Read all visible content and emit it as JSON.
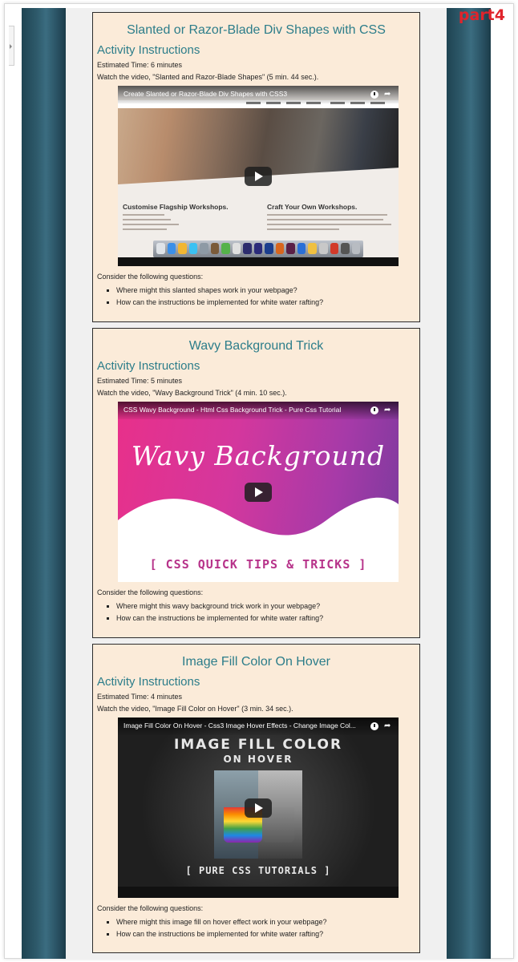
{
  "page": {
    "part_label": "part4"
  },
  "cards": [
    {
      "title": "Slanted or Razor-Blade Div Shapes with CSS",
      "instructions_heading": "Activity Instructions",
      "estimated_time": "Estimated Time: 6 minutes",
      "watch_text": "Watch the video, \"Slanted and Razor-Blade Shapes\" (5 min. 44 sec.).",
      "video": {
        "title": "Create Slanted or Razor-Blade Div Shapes with CSS3",
        "thumb_text_1": "Customise Flagship Workshops.",
        "thumb_text_2": "Craft Your Own Workshops."
      },
      "questions_intro": "Consider the following questions:",
      "questions": [
        "Where might this slanted shapes work in your webpage?",
        "How can the instructions be implemented for white water rafting?"
      ]
    },
    {
      "title": "Wavy Background Trick",
      "instructions_heading": "Activity Instructions",
      "estimated_time": "Estimated Time: 5 minutes",
      "watch_text": "Watch the video, \"Wavy Background Trick\" (4 min. 10 sec.).",
      "video": {
        "title": "CSS Wavy Background - Html Css Background Trick - Pure Css Tutorial",
        "thumb_text_1": "Wavy Background",
        "thumb_text_2": "[ CSS QUICK TIPS & TRICKS ]"
      },
      "questions_intro": "Consider the following questions:",
      "questions": [
        "Where might this wavy background trick work in your webpage?",
        "How can the instructions be implemented for white water rafting?"
      ]
    },
    {
      "title": "Image Fill Color On Hover",
      "instructions_heading": "Activity Instructions",
      "estimated_time": "Estimated Time: 4 minutes",
      "watch_text": "Watch the video, \"Image Fill Color on Hover\" (3 min. 34 sec.).",
      "video": {
        "title": "Image Fill Color On Hover - Css3 Image Hover Effects - Change Image Col...",
        "thumb_text_1": "IMAGE FILL COLOR",
        "thumb_text_2": "ON HOVER",
        "thumb_text_3": "[ PURE CSS TUTORIALS ]"
      },
      "questions_intro": "Consider the following questions:",
      "questions": [
        "Where might this image fill on hover effect work in your webpage?",
        "How can the instructions be implemented for white water rafting?"
      ]
    }
  ],
  "colors": {
    "heading": "#2c7d8a",
    "card_background": "#fbebd9",
    "side_bars": "#2e5a6b",
    "part_label": "#e0242c"
  }
}
